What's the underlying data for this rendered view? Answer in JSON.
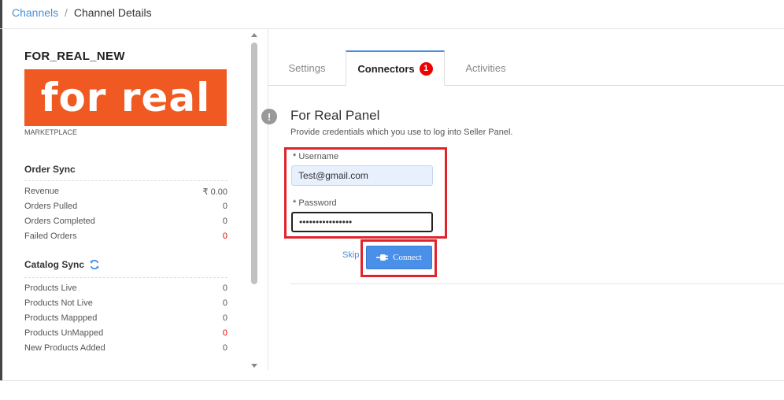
{
  "breadcrumb": {
    "parent": "Channels",
    "separator": "/",
    "current": "Channel Details"
  },
  "channel": {
    "name": "FOR_REAL_NEW",
    "logo_text": "for real",
    "type": "MARKETPLACE",
    "brand_color": "#f05a22"
  },
  "order_sync": {
    "title": "Order Sync",
    "rows": [
      {
        "label": "Revenue",
        "value": "₹ 0.00"
      },
      {
        "label": "Orders Pulled",
        "value": "0"
      },
      {
        "label": "Orders Completed",
        "value": "0"
      },
      {
        "label": "Failed Orders",
        "value": "0"
      }
    ]
  },
  "catalog_sync": {
    "title": "Catalog Sync",
    "refresh_icon": "refresh-icon",
    "rows": [
      {
        "label": "Products Live",
        "value": "0"
      },
      {
        "label": "Products Not Live",
        "value": "0"
      },
      {
        "label": "Products Mappped",
        "value": "0"
      },
      {
        "label": "Products UnMapped",
        "value": "0"
      },
      {
        "label": "New Products Added",
        "value": "0"
      }
    ]
  },
  "tabs": [
    {
      "label": "Settings"
    },
    {
      "label": "Connectors",
      "badge": "1"
    },
    {
      "label": "Activities"
    }
  ],
  "panel": {
    "info_icon": "!",
    "title": "For Real Panel",
    "subtitle": "Provide credentials which you use to log into Seller Panel.",
    "username_required": "*",
    "username_label": "Username",
    "username_value": "Test@gmail.com",
    "password_required": "*",
    "password_label": "Password",
    "password_value": "••••••••••••••••",
    "skip_label": "Skip",
    "connect_label": "Connect"
  },
  "colors": {
    "accent": "#4a90d9",
    "highlight": "#e0242b",
    "error_value": "#ee0000"
  }
}
